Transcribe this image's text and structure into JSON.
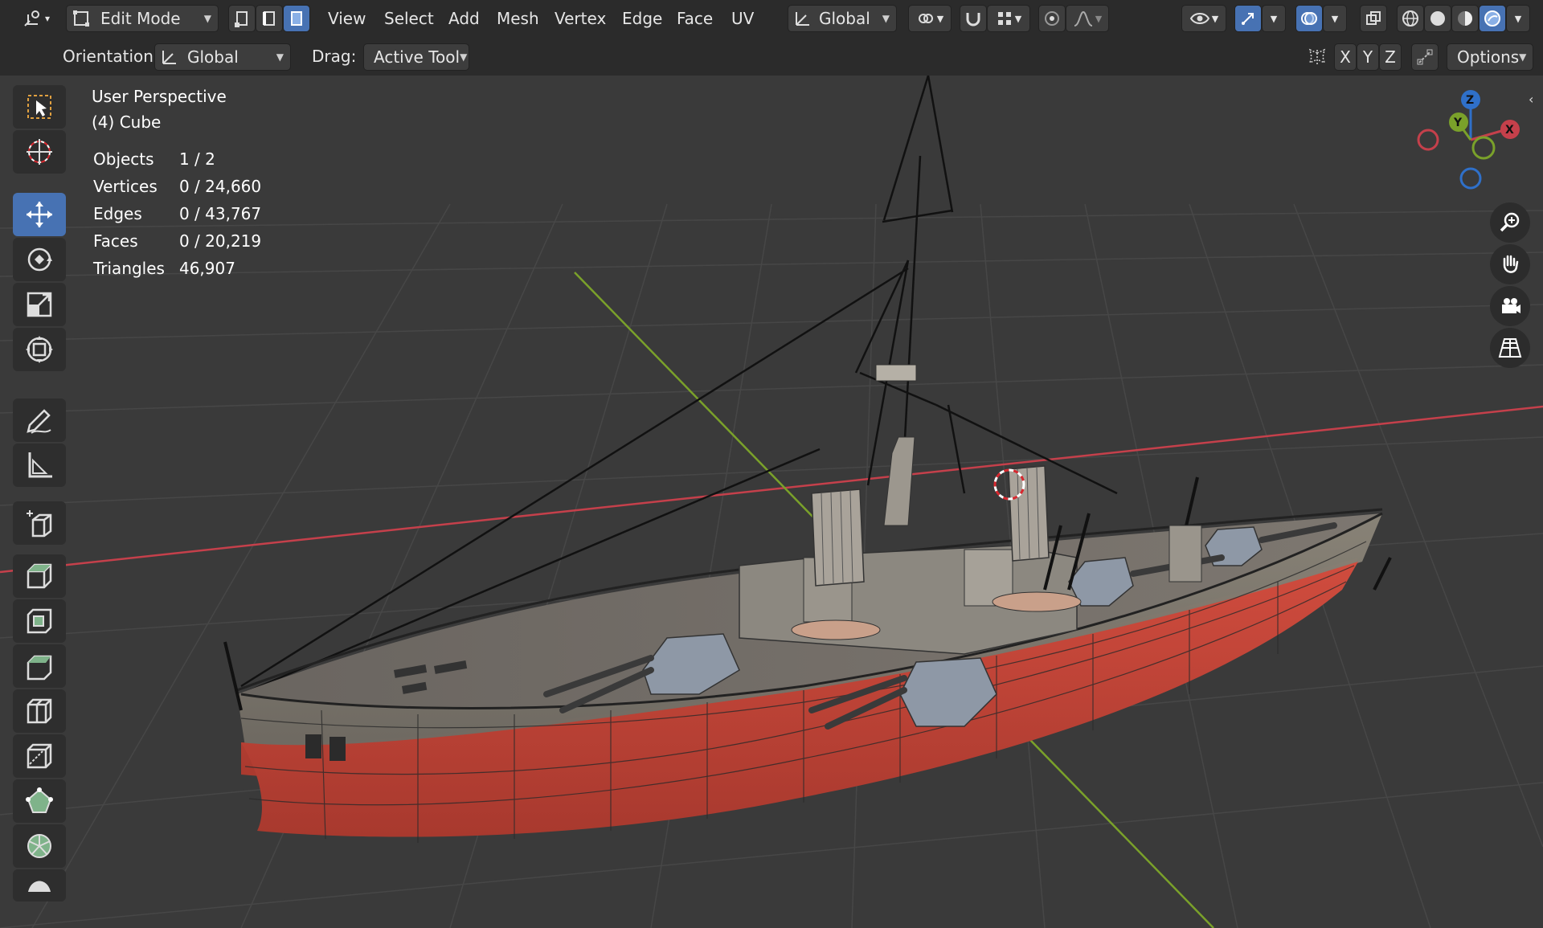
{
  "header": {
    "mode_label": "Edit Mode",
    "menus": [
      "View",
      "Select",
      "Add",
      "Mesh",
      "Vertex",
      "Edge",
      "Face",
      "UV"
    ],
    "transform_orientation": "Global"
  },
  "tool_settings": {
    "orientation_label": "Orientation:",
    "orientation_value": "Global",
    "drag_label": "Drag:",
    "drag_value": "Active Tool",
    "axis_x": "X",
    "axis_y": "Y",
    "axis_z": "Z",
    "options_label": "Options"
  },
  "overlay": {
    "view_name": "User Perspective",
    "object_name": "(4) Cube"
  },
  "stats": [
    {
      "label": "Objects",
      "value": "1 / 2"
    },
    {
      "label": "Vertices",
      "value": "0 / 24,660"
    },
    {
      "label": "Edges",
      "value": "0 / 43,767"
    },
    {
      "label": "Faces",
      "value": "0 / 20,219"
    },
    {
      "label": "Triangles",
      "value": "46,907"
    }
  ],
  "gizmo": {
    "x": "X",
    "y": "Y",
    "z": "Z"
  },
  "toolbar_tools": [
    "select-box",
    "cursor",
    "move",
    "rotate",
    "scale",
    "transform",
    "annotate",
    "measure",
    "add-cube",
    "extrude",
    "inset",
    "bevel",
    "loop-cut",
    "knife",
    "poly-build",
    "spin",
    "smooth"
  ],
  "colors": {
    "accent": "#4772b3",
    "x_axis": "#c5404b",
    "y_axis": "#7aa12a",
    "hull_red": "#c6463a",
    "grid": "#474747"
  }
}
